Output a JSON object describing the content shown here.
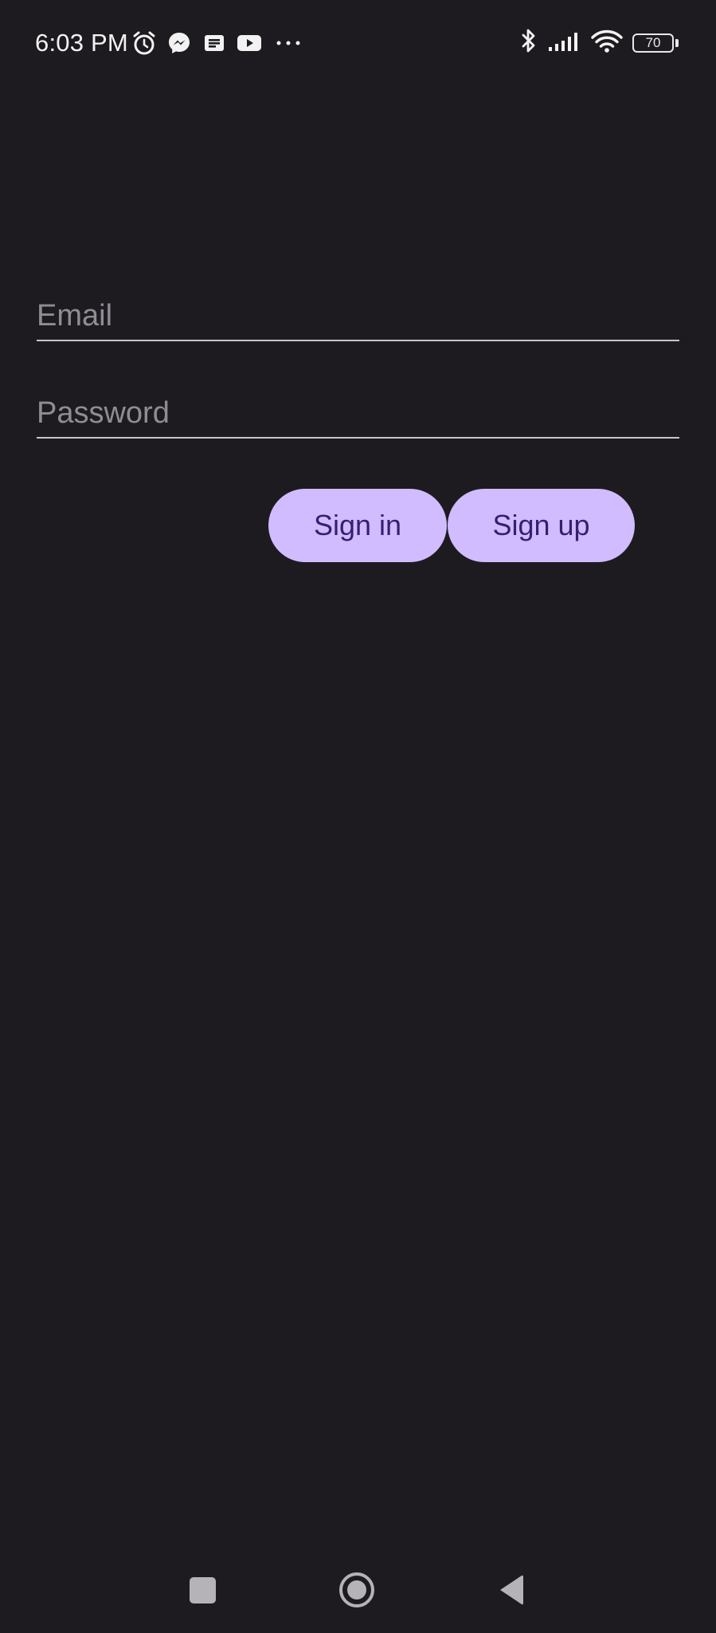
{
  "status_bar": {
    "time": "6:03 PM",
    "battery_level": "70",
    "left_icons": [
      "alarm-icon",
      "messenger-icon",
      "news-icon",
      "youtube-icon",
      "more-notifications-icon"
    ],
    "right_icons": [
      "bluetooth-icon",
      "signal-icon",
      "wifi-icon",
      "battery-icon"
    ]
  },
  "form": {
    "email": {
      "placeholder": "Email",
      "value": ""
    },
    "password": {
      "placeholder": "Password",
      "value": ""
    },
    "signin_label": "Sign in",
    "signup_label": "Sign up"
  },
  "nav_bar": {
    "buttons": [
      "recents-button",
      "home-button",
      "back-button"
    ]
  },
  "colors": {
    "background": "#1d1b20",
    "button_bg": "#d0bcff",
    "button_text": "#381e72",
    "field_underline": "#cac4cf",
    "placeholder": "#8f8d93"
  }
}
